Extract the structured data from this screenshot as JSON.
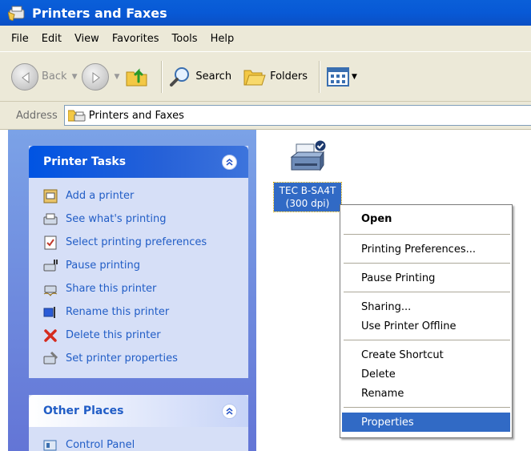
{
  "window": {
    "title": "Printers and Faxes"
  },
  "menu": [
    "File",
    "Edit",
    "View",
    "Favorites",
    "Tools",
    "Help"
  ],
  "toolbar": {
    "back": "Back",
    "search": "Search",
    "folders": "Folders"
  },
  "address": {
    "label": "Address",
    "value": "Printers and Faxes"
  },
  "printer_tasks": {
    "title": "Printer Tasks",
    "items": [
      {
        "label": "Add a printer",
        "icon": "add-printer-icon"
      },
      {
        "label": "See what's printing",
        "icon": "print-queue-icon"
      },
      {
        "label": "Select printing preferences",
        "icon": "preferences-icon"
      },
      {
        "label": "Pause printing",
        "icon": "pause-printer-icon"
      },
      {
        "label": "Share this printer",
        "icon": "share-printer-icon"
      },
      {
        "label": "Rename this printer",
        "icon": "rename-icon"
      },
      {
        "label": "Delete this printer",
        "icon": "delete-icon"
      },
      {
        "label": "Set printer properties",
        "icon": "properties-icon"
      }
    ]
  },
  "other_places": {
    "title": "Other Places",
    "items": [
      {
        "label": "Control Panel",
        "icon": "control-panel-icon"
      }
    ]
  },
  "printer": {
    "name_line1": "TEC B-SA4T",
    "name_line2": "(300 dpi)"
  },
  "context_menu": {
    "open": "Open",
    "printing_preferences": "Printing Preferences...",
    "pause_printing": "Pause Printing",
    "sharing": "Sharing...",
    "use_offline": "Use Printer Offline",
    "create_shortcut": "Create Shortcut",
    "delete": "Delete",
    "rename": "Rename",
    "properties": "Properties"
  },
  "colors": {
    "titlebar": "#0a5fd8",
    "selection": "#316ac5",
    "task_link": "#215dc6",
    "pane": "#7ba2e7"
  }
}
